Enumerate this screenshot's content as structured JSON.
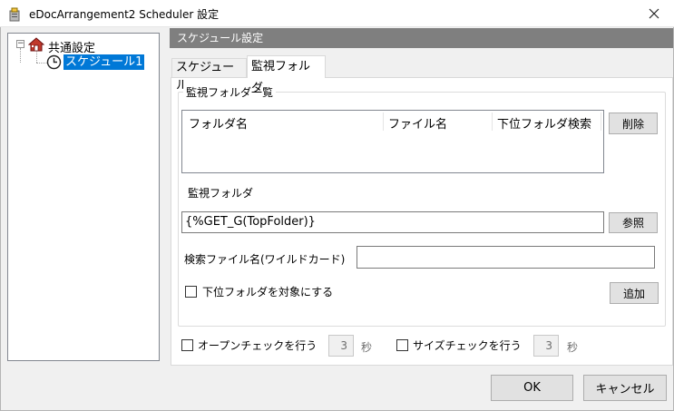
{
  "window": {
    "title": "eDocArrangement2 Scheduler 設定"
  },
  "tree": {
    "root_label": "共通設定",
    "child_label": "スケジュール1",
    "expander": "−"
  },
  "header": {
    "title": "スケジュール設定"
  },
  "tabs": [
    {
      "label": "スケジュール"
    },
    {
      "label": "監視フォルダ"
    }
  ],
  "group": {
    "legend": "監視フォルダ一覧",
    "columns": [
      "フォルダ名",
      "ファイル名",
      "下位フォルダ検索"
    ],
    "delete_label": "削除",
    "watch_folder_label": "監視フォルダ",
    "watch_folder_value": "{%GET_G(TopFolder)}",
    "browse_label": "参照",
    "search_file_label": "検索ファイル名(ワイルドカード)",
    "search_file_value": "",
    "subfolder_label": "下位フォルダを対象にする",
    "add_label": "追加"
  },
  "options": {
    "open_check_label": "オープンチェックを行う",
    "open_check_value": "3",
    "size_check_label": "サイズチェックを行う",
    "size_check_value": "3",
    "seconds_unit": "秒"
  },
  "footer": {
    "ok_label": "OK",
    "cancel_label": "キャンセル"
  },
  "colors": {
    "selection": "#0078d7",
    "header_bg": "#7f7f7f"
  }
}
